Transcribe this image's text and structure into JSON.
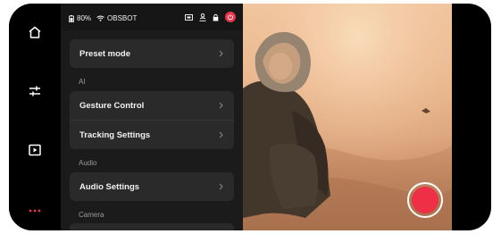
{
  "status_bar": {
    "battery": "80%",
    "network": "OBSBOT"
  },
  "rail": {
    "icons": [
      "home-icon",
      "adjust-icon",
      "media-icon",
      "more-icon"
    ],
    "accent": "#e8354a"
  },
  "settings": {
    "preset_mode": "Preset mode",
    "sections": [
      {
        "title": "AI",
        "items": [
          "Gesture Control",
          "Tracking Settings"
        ]
      },
      {
        "title": "Audio",
        "items": [
          "Audio Settings"
        ]
      },
      {
        "title": "Camera",
        "items": []
      }
    ]
  },
  "camera": {
    "record_color": "#ee2f45"
  }
}
